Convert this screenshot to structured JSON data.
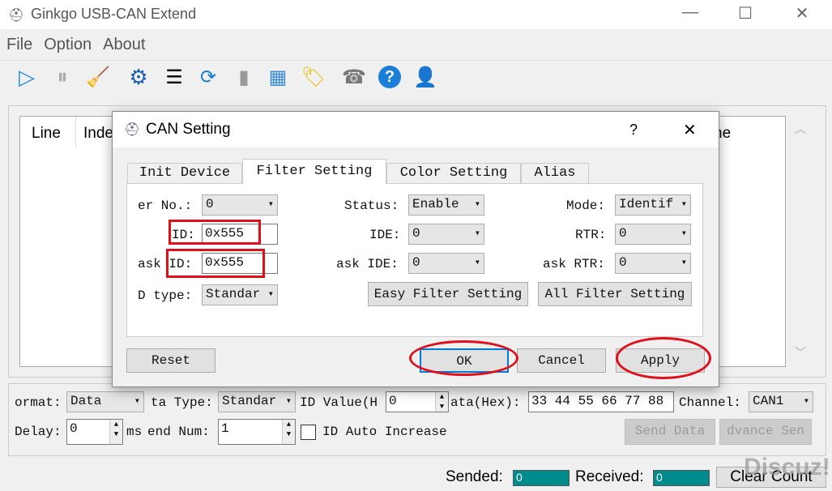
{
  "window": {
    "title": "Ginkgo USB-CAN Extend",
    "minimize": "—",
    "maximize": "☐",
    "close": "✕"
  },
  "menu": [
    "File",
    "Option",
    "About"
  ],
  "toolbar": [
    "play-icon",
    "pause-icon",
    "broom-icon",
    "gear-icon",
    "list-icon",
    "refresh-icon",
    "bar-chart-icon",
    "palette-icon",
    "tag-icon",
    "fax-icon",
    "help-icon",
    "user-info-icon"
  ],
  "table": {
    "headers": [
      "Line",
      "Inde",
      "ne"
    ]
  },
  "send_panel": {
    "format_label": "ormat:",
    "format": "Data",
    "data_type_label": "ta Type:",
    "data_type": "Standar",
    "id_value_label": "ID Value(H",
    "id_value": "0",
    "data_hex_label": "ata(Hex):",
    "data_hex": "33 44 55 66 77 88",
    "channel_label": "Channel:",
    "channel": "CAN1",
    "delay_label": "Delay:",
    "delay": "0",
    "ms_label": "ms",
    "send_num_label": "end Num:",
    "send_num": "1",
    "id_auto": "ID Auto Increase",
    "send_data": "Send Data",
    "advance_send": "dvance Sen"
  },
  "status": {
    "sended_label": "Sended:",
    "sended": "0",
    "received_label": "Received:",
    "received": "0",
    "clear": "Clear Count"
  },
  "watermark": "Discuz!",
  "dialog": {
    "title": "CAN Setting",
    "help": "?",
    "close": "✕",
    "tabs": [
      "Init Device",
      "Filter Setting",
      "Color Setting",
      "Alias"
    ],
    "active_tab": "Filter Setting",
    "filter_no_label": "er No.:",
    "filter_no": "0",
    "id_label": "ID:",
    "id": "0x555",
    "mask_id_label": "ask ID:",
    "mask_id": "0x555",
    "id_type_label": "D type:",
    "id_type": "Standar",
    "status_label": "Status:",
    "status": "Enable",
    "ide_label": "IDE:",
    "ide": "0",
    "mask_ide_label": "ask IDE:",
    "mask_ide": "0",
    "mode_label": "Mode:",
    "mode": "Identif",
    "rtr_label": "RTR:",
    "rtr": "0",
    "mask_rtr_label": "ask RTR:",
    "mask_rtr": "0",
    "easy_filter": "Easy Filter Setting",
    "all_filter": "All Filter Setting",
    "reset": "Reset",
    "ok": "OK",
    "cancel": "Cancel",
    "apply": "Apply"
  },
  "colors": {
    "annotation": "#e0101a",
    "counter": "#008c8c"
  }
}
